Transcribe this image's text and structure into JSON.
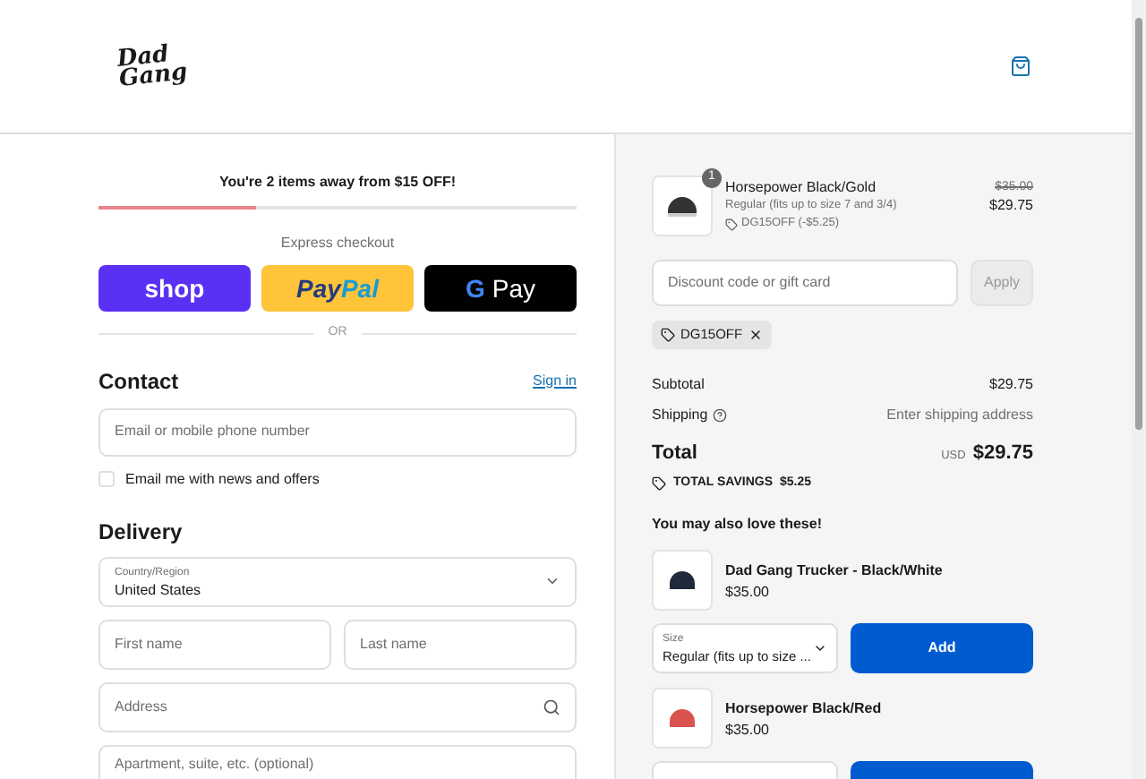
{
  "header": {
    "logo_top": "Dad",
    "logo_bottom": "Gang"
  },
  "promo": {
    "text": "You're 2 items away from $15 OFF!",
    "level": 0.33
  },
  "express": {
    "title": "Express checkout",
    "divider": "OR",
    "buttons": [
      {
        "kind": "shop",
        "label": "shop"
      },
      {
        "kind": "paypal",
        "label": "Pay",
        "label2": "Pal"
      },
      {
        "kind": "gpay",
        "mark": "G",
        "label": "Pay"
      }
    ]
  },
  "contact": {
    "title": "Contact",
    "link": "Sign in",
    "email_placeholder": "Email or mobile phone number",
    "newsletter": {
      "label": "Email me with news and offers",
      "checked": false
    }
  },
  "delivery": {
    "title": "Delivery",
    "country": {
      "label": "Country/Region",
      "value": "United States"
    },
    "rows": [
      [
        {
          "kind": "text",
          "placeholder": "First name"
        },
        {
          "kind": "text",
          "placeholder": "Last name"
        }
      ],
      [
        {
          "kind": "search",
          "placeholder": "Address"
        }
      ],
      [
        {
          "kind": "text",
          "placeholder": "Apartment, suite, etc. (optional)"
        }
      ]
    ]
  },
  "summary": {
    "item": {
      "quantity": "1",
      "name": "Horsepower Black/Gold",
      "variant": "Regular (fits up to size 7 and 3/4)",
      "discount": "DG15OFF (-$5.25)",
      "original_price": "$35.00",
      "price": "$29.75"
    },
    "discount": {
      "placeholder": "Discount code or gift card",
      "button": "Apply",
      "disabled": true
    },
    "applied_code": "DG15OFF",
    "lines": [
      {
        "label": "Subtotal",
        "value": "$29.75",
        "info": false
      },
      {
        "label": "Shipping",
        "value": "Enter shipping address",
        "info": true
      }
    ],
    "total": {
      "label": "Total",
      "currency": "USD",
      "amount": "$29.75"
    },
    "savings": {
      "label": "TOTAL SAVINGS",
      "amount": "$5.25"
    },
    "upsell": {
      "title": "You may also love these!",
      "items": [
        {
          "name": "Dad Gang Trucker - Black/White",
          "price": "$35.00",
          "size": {
            "label": "Size",
            "value": "Regular (fits up to size ..."
          },
          "button": "Add"
        },
        {
          "name": "Horsepower Black/Red",
          "price": "$35.00"
        }
      ]
    }
  }
}
